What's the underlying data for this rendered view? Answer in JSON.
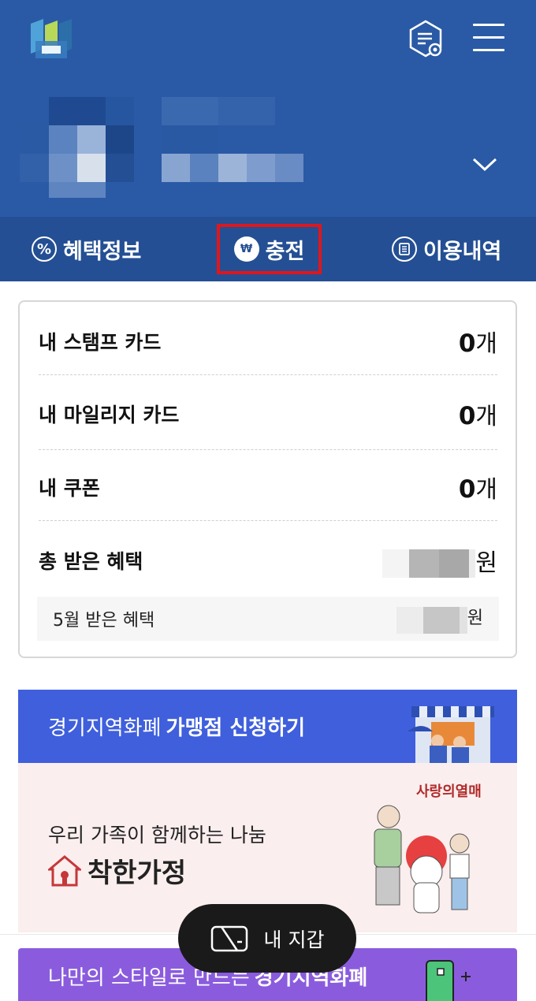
{
  "header": {
    "logo_icon": "gyeonggi-logo",
    "settings_icon": "settings-document-icon",
    "menu_icon": "hamburger-menu-icon",
    "expand_icon": "chevron-down-icon"
  },
  "tabs": [
    {
      "label": "혜택정보",
      "icon": "percent-icon"
    },
    {
      "label": "충전",
      "icon": "won-icon"
    },
    {
      "label": "이용내역",
      "icon": "document-icon"
    }
  ],
  "summary": {
    "stamp_label": "내 스탬프 카드",
    "stamp_count": "0",
    "stamp_unit": "개",
    "mileage_label": "내 마일리지 카드",
    "mileage_count": "0",
    "mileage_unit": "개",
    "coupon_label": "내 쿠폰",
    "coupon_count": "0",
    "coupon_unit": "개",
    "total_label": "총 받은 혜택",
    "total_unit": "원",
    "month_label": "5월 받은 혜택",
    "month_unit": "원"
  },
  "banner_merchant": {
    "text": "경기지역화폐",
    "bold": "가맹점 신청하기"
  },
  "banner_family": {
    "line1": "우리 가족이 함께하는 나눔",
    "title": "착한가정",
    "brand": "사랑의열매"
  },
  "wallet": {
    "label": "내 지갑"
  },
  "banner_style": {
    "text": "나만의 스타일로 만드는",
    "bold": "경기지역화폐"
  },
  "colors": {
    "header_bg": "#2a5aa6",
    "tabbar_bg": "#244f94",
    "highlight": "#e0161c",
    "banner_blue": "#3f5fdc",
    "banner_pink": "#fbeeee",
    "banner_purple": "#8a5cdd"
  }
}
